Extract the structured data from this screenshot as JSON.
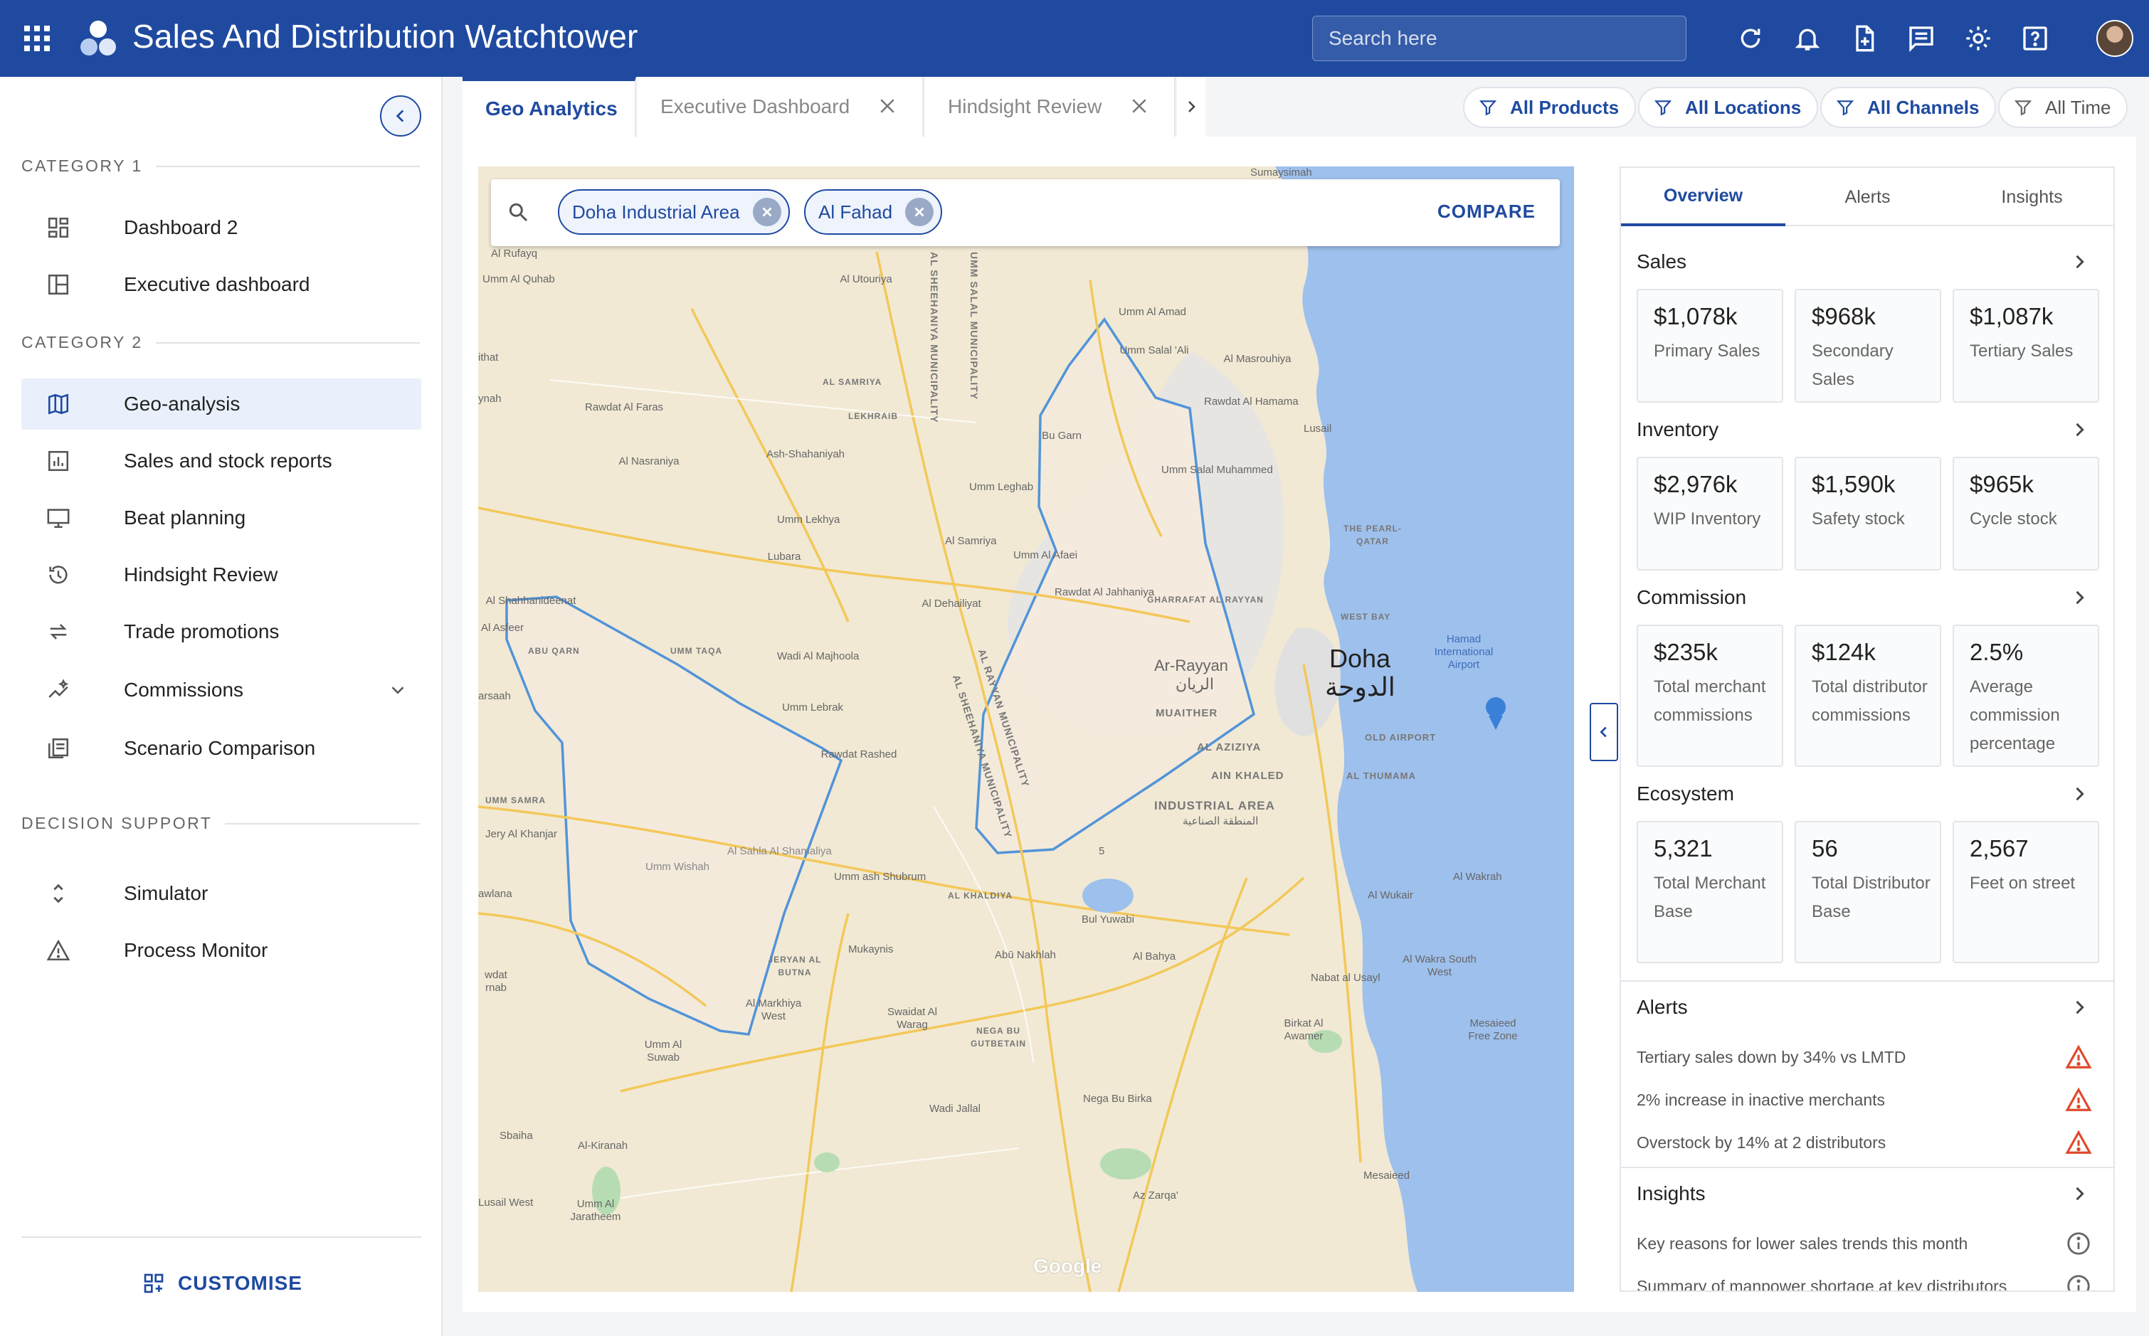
{
  "header": {
    "app_title": "Sales And Distribution Watchtower",
    "search_placeholder": "Search here",
    "icons": [
      "apps-grid-icon",
      "refresh-icon",
      "notifications-icon",
      "add-document-icon",
      "chat-icon",
      "settings-icon",
      "help-icon"
    ]
  },
  "sidebar": {
    "categories": [
      {
        "label": "CATEGORY 1"
      },
      {
        "label": "CATEGORY 2"
      },
      {
        "label": "DECISION SUPPORT"
      }
    ],
    "items": [
      {
        "label": "Dashboard 2",
        "icon": "dashboard-grid-icon"
      },
      {
        "label": "Executive dashboard",
        "icon": "layout-icon"
      },
      {
        "label": "Geo-analysis",
        "icon": "map-icon",
        "active": true
      },
      {
        "label": "Sales and stock reports",
        "icon": "report-icon"
      },
      {
        "label": "Beat planning",
        "icon": "monitor-icon"
      },
      {
        "label": "Hindsight Review",
        "icon": "history-icon"
      },
      {
        "label": "Trade promotions",
        "icon": "swap-icon"
      },
      {
        "label": "Commissions",
        "icon": "sparkle-chart-icon"
      },
      {
        "label": "Scenario Comparison",
        "icon": "copy-list-icon"
      },
      {
        "label": "Simulator",
        "icon": "unfold-icon"
      },
      {
        "label": "Process Monitor",
        "icon": "warning-icon"
      }
    ],
    "customise_label": "CUSTOMISE"
  },
  "tabs": [
    {
      "label": "Geo Analytics",
      "active": true
    },
    {
      "label": "Executive Dashboard"
    },
    {
      "label": "Hindsight Review"
    }
  ],
  "filters": [
    {
      "label": "All Products"
    },
    {
      "label": "All Locations"
    },
    {
      "label": "All Channels"
    },
    {
      "label": "All Time"
    }
  ],
  "map": {
    "chips": [
      "Doha Industrial Area",
      "Al Fahad"
    ],
    "compare_label": "COMPARE",
    "attribution": "Google",
    "labels": {
      "sumaysimah": "Sumaysimah",
      "doha_en": "Doha",
      "doha_ar": "الدوحة",
      "ar_rayyan": "Ar-Rayyan",
      "ar_rayyan_ar": "الريان",
      "industrial_area": "INDUSTRIAL AREA",
      "industrial_area_ar": "المنطقة الصناعية",
      "al_rufayq": "Al Rufayq",
      "umm_al_quhab": "Umm Al Quhab",
      "al_utouriya": "Al Utouriya",
      "umm_amad": "Umm Al Amad",
      "umm_salal_ali": "Umm Salal 'Ali",
      "al_masrouhiya": "Al Masrouhiya",
      "rawdat_al_hamama": "Rawdat Al Hamama",
      "lusail": "Lusail",
      "rawdat_al_faras": "Rawdat Al Faras",
      "ash_shahaniyah": "Ash-Shahaniyah",
      "al_nasraniya": "Al Nasraniya",
      "bu_garn": "Bu Garn",
      "umm_salal_muhammed": "Umm Salal Muhammed",
      "umm_leghab": "Umm Leghab",
      "umm_lekhya": "Umm Lekhya",
      "al_samriya": "Al Samriya",
      "umm_al_afaei": "Umm Al Afaei",
      "lubara": "Lubara",
      "al_dehailiyat": "Al Dehailiyat",
      "al_jahhaniya": "Rawdat Al Jahhaniya",
      "al_shahhaniya": "Al Shahhaniya",
      "wadi_al_majhoola": "Wadi Al Majhoola",
      "umm_lebrak": "Umm Lebrak",
      "rawdat_rashed": "Rawdat Rashed",
      "hamad_airport": "Hamad International Airport",
      "west_bay": "WEST BAY",
      "the_pearl": "THE PEARL-QATAR",
      "old_airport": "OLD AIRPORT",
      "al_thumama": "AL THUMAMA",
      "ain_khaled": "AIN KHALED",
      "al_aziziya": "AL AZIZIYA",
      "muaither": "MUAITHER",
      "gharrafat": "GHARRAFAT AL RAYYAN",
      "abu_qarn": "ABU QARN",
      "umm_taqa": "UMM TAQA",
      "umm_samra": "UMM SAMRA",
      "jery_al_khanjar": "Jery Al Khanjar",
      "al_sahla": "Al Sahla Al Shamaliya",
      "umm_wishah": "Umm Wishah",
      "umm_ash_shubrum": "Umm ash Shubrum",
      "al_khaldiya": "AL KHALDIYA",
      "bul_yuwabi": "Bul Yuwabi",
      "al_wukair": "Al Wukair",
      "al_wakrah": "Al Wakrah",
      "mukaynis": "Mukaynis",
      "abu_nakhlah": "Abū Nakhlah",
      "al_bahya": "Al Bahya",
      "nabat_al_usayl": "Nabat al Usayl",
      "al_wakra_sw": "Al Wakra South West",
      "jeryan_al_butna": "JERYAN AL BUTNA",
      "al_markhiya_west": "Al Markhiya West",
      "swaidat": "Swaidat Al Warag",
      "nega_bu_gutbetain": "NEGA BU GUTBETAIN",
      "birkat_al_awamer": "Birkat Al Awamer",
      "mesaieed_free_zone": "Mesaieed Free Zone",
      "umm_al_suwab": "Umm Al Suwab",
      "wadi_jallal": "Wadi Jallal",
      "nega_bu_birka": "Nega Bu Birka",
      "sbaiha": "Sbaiha",
      "al_kiranah": "Al-Kiranah",
      "umm_al_jaratheem": "Umm Al Jaratheem",
      "lusail_west": "Lusail West",
      "az_zarqa": "Az Zarqa'",
      "mesaieed": "Mesaieed",
      "al_shahaniya_muni": "AL SHEEHANIYA MUNICIPALITY",
      "umm_salal_muni": "UMM SALAL MUNICIPALITY",
      "al_rayyan_muni": "AL RAYYAN MUNICIPALITY",
      "al_sheehaniya_muni2": "AL SHEEHANIYA MUNICIPALITY",
      "al_asfeer": "Al Asfeer",
      "al_shahhanideenat": "Al Shahhanideenat",
      "lekhraib": "LEKHRAIB",
      "al_samriya_upper": "AL SAMRIYA",
      "ithat": "ithat",
      "arsaah": "arsaah",
      "awlana": "awlana",
      "wdat_rnab": "wdat rnab",
      "ynah": "ynah",
      "route_5": "5"
    },
    "polygon_color": "#4a90d9",
    "water_color": "#9ec0ec"
  },
  "right_panel": {
    "tabs": [
      {
        "label": "Overview",
        "active": true
      },
      {
        "label": "Alerts"
      },
      {
        "label": "Insights"
      }
    ],
    "sections": [
      {
        "title": "Sales",
        "cards": [
          {
            "value": "$1,078k",
            "desc": "Primary Sales"
          },
          {
            "value": "$968k",
            "desc": "Secondary Sales"
          },
          {
            "value": "$1,087k",
            "desc": "Tertiary Sales"
          }
        ]
      },
      {
        "title": "Inventory",
        "cards": [
          {
            "value": "$2,976k",
            "desc": "WIP Inventory"
          },
          {
            "value": "$1,590k",
            "desc": "Safety stock"
          },
          {
            "value": "$965k",
            "desc": "Cycle stock"
          }
        ]
      },
      {
        "title": "Commission",
        "cards": [
          {
            "value": "$235k",
            "desc": "Total merchant commissions"
          },
          {
            "value": "$124k",
            "desc": "Total distributor commissions"
          },
          {
            "value": "2.5%",
            "desc": "Average commission percentage"
          }
        ]
      },
      {
        "title": "Ecosystem",
        "cards": [
          {
            "value": "5,321",
            "desc": "Total Merchant Base"
          },
          {
            "value": "56",
            "desc": "Total Distributor Base"
          },
          {
            "value": "2,567",
            "desc": "Feet on street"
          }
        ]
      }
    ],
    "alerts": {
      "title": "Alerts",
      "items": [
        "Tertiary sales down by 34% vs LMTD",
        "2% increase in inactive merchants",
        "Overstock by 14% at 2 distributors"
      ],
      "icon_color": "#e0492c"
    },
    "insights": {
      "title": "Insights",
      "items": [
        "Key reasons for lower sales trends this month",
        "Summary of manpower shortage at key distributors"
      ]
    }
  },
  "colors": {
    "brand": "#1f4aa0",
    "active_bg": "#e9f0fb"
  }
}
